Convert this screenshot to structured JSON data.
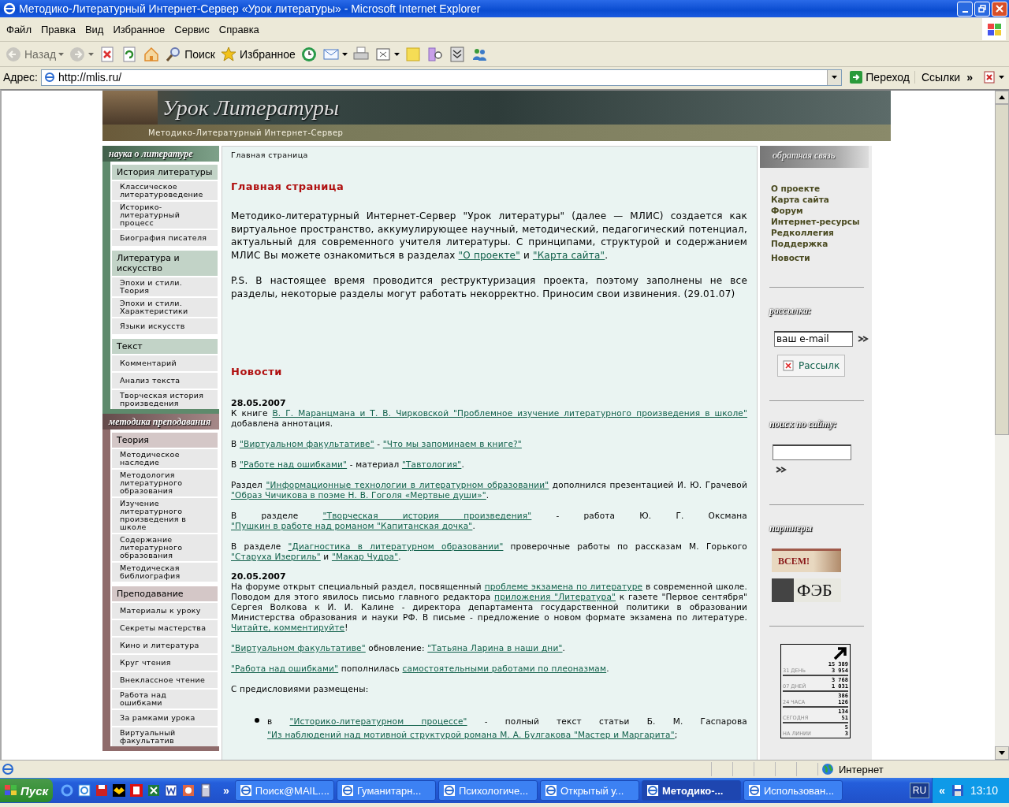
{
  "window": {
    "title": "Методико-Литературный Интернет-Сервер «Урок литературы» - Microsoft Internet Explorer"
  },
  "menu": [
    "Файл",
    "Правка",
    "Вид",
    "Избранное",
    "Сервис",
    "Справка"
  ],
  "toolbar": [
    {
      "kind": "back",
      "label": "Назад",
      "disabled": true,
      "dropdown": true
    },
    {
      "kind": "forward",
      "disabled": true,
      "dropdown": true
    },
    {
      "kind": "stop",
      "disabled": false,
      "dropdown": false
    },
    {
      "kind": "refresh",
      "disabled": false,
      "dropdown": false
    },
    {
      "kind": "home",
      "disabled": false,
      "dropdown": false
    },
    {
      "kind": "search",
      "label": "Поиск",
      "disabled": false,
      "dropdown": false
    },
    {
      "kind": "favorites",
      "label": "Избранное",
      "disabled": false,
      "dropdown": false
    },
    {
      "kind": "history",
      "disabled": false,
      "dropdown": false
    },
    {
      "kind": "mail",
      "disabled": false,
      "dropdown": true
    },
    {
      "kind": "print",
      "disabled": false,
      "dropdown": false
    },
    {
      "kind": "edit",
      "disabled": false,
      "dropdown": true
    },
    {
      "kind": "note",
      "disabled": false,
      "dropdown": false
    },
    {
      "kind": "research",
      "disabled": false,
      "dropdown": false
    },
    {
      "kind": "archive",
      "disabled": false,
      "dropdown": false
    },
    {
      "kind": "people",
      "disabled": false,
      "dropdown": false
    }
  ],
  "address": {
    "label": "Адрес:",
    "value": "http://mlis.ru/",
    "go": "Переход",
    "links": "Ссылки",
    "chevron": "»"
  },
  "site": {
    "title": "Урок Литературы",
    "subtitle": "Методико-Литературный Интернет-Сервер"
  },
  "left_sections": [
    {
      "heading": "наука о литературе",
      "color": "#5e8a6c",
      "groups": [
        {
          "title": "История литературы",
          "items": [
            "Классическое литературоведение",
            "Историко-литературный процесс",
            "Биография писателя"
          ]
        },
        {
          "title": "Литература и искусство",
          "items": [
            "Эпохи и стили. Теория",
            "Эпохи и стили. Характеристики",
            "Языки искусств"
          ]
        },
        {
          "title": "Текст",
          "items": [
            "Комментарий",
            "Анализ текста",
            "Творческая история произведения"
          ]
        }
      ]
    },
    {
      "heading": "методика преподавания",
      "color": "#8f6b6b",
      "groups": [
        {
          "title": "Теория",
          "items": [
            "Методическое наследие",
            "Методология литературного образования",
            "Изучение литературного произведения в школе",
            "Содержание литературного образования",
            "Методическая библиография"
          ]
        },
        {
          "title": "Преподавание",
          "items": [
            "Материалы к уроку",
            "Секреты мастерства",
            "Кино и литература",
            "Круг чтения",
            "Внеклассное чтение",
            "Работа над ошибками",
            "За рамками урока",
            "Виртуальный факультатив"
          ]
        }
      ]
    }
  ],
  "main": {
    "breadcrumb": "Главная страница",
    "heading": "Главная страница",
    "intro": [
      [
        {
          "kind": "text",
          "text": "Методико-литературный Интернет-Сервер \"Урок литературы\" (далее — МЛИС) создается как виртуальное пространство, аккумулирующее научный, методический, педагогический потенциал, актуальный для современного учителя литературы. С принципами, структурой и содержанием МЛИС Вы можете ознакомиться в разделах "
        },
        {
          "kind": "link",
          "text": "\"О проекте\""
        },
        {
          "kind": "text",
          "text": " и "
        },
        {
          "kind": "link",
          "text": "\"Карта сайта\""
        },
        {
          "kind": "text",
          "text": "."
        }
      ],
      [
        {
          "kind": "text",
          "text": "P.S. В настоящее время проводится реструктуризация проекта, поэтому заполнены не все разделы, некоторые разделы могут работать некорректно. Приносим свои извинения. (29.01.07)"
        }
      ]
    ],
    "news_heading": "Новости",
    "news": [
      {
        "date": "28.05.2007",
        "paragraphs": [
          [
            {
              "kind": "text",
              "text": "К книге "
            },
            {
              "kind": "link",
              "text": "В. Г. Маранцмана и Т. В. Чирковской \"Проблемное изучение литературного произведения в школе\""
            },
            {
              "kind": "text",
              "text": " добавлена аннотация."
            }
          ],
          [
            {
              "kind": "text",
              "text": "В "
            },
            {
              "kind": "link",
              "text": "\"Виртуальном факультативе\""
            },
            {
              "kind": "text",
              "text": " - "
            },
            {
              "kind": "link",
              "text": "\"Что мы запоминаем в книге?\""
            }
          ],
          [
            {
              "kind": "text",
              "text": "В "
            },
            {
              "kind": "link",
              "text": "\"Работе над ошибками\""
            },
            {
              "kind": "text",
              "text": " - материал "
            },
            {
              "kind": "link",
              "text": "\"Тавтология\""
            },
            {
              "kind": "text",
              "text": "."
            }
          ],
          [
            {
              "kind": "text",
              "text": "Раздел "
            },
            {
              "kind": "link",
              "text": "\"Информационные технологии в литературном образовании\""
            },
            {
              "kind": "text",
              "text": " дополнился презентацией И. Ю. Грачевой "
            },
            {
              "kind": "link",
              "text": "\"Образ Чичикова в поэме Н. В. Гоголя «Мертвые души»\""
            },
            {
              "kind": "text",
              "text": "."
            }
          ],
          [
            {
              "kind": "text",
              "text": "В разделе "
            },
            {
              "kind": "link",
              "text": "\"Творческая история произведения\""
            },
            {
              "kind": "text",
              "text": " - работа Ю. Г. Оксмана "
            },
            {
              "kind": "link",
              "text": "\"Пушкин в работе над романом \"Капитанская дочка\""
            },
            {
              "kind": "text",
              "text": "."
            }
          ],
          [
            {
              "kind": "text",
              "text": "В разделе "
            },
            {
              "kind": "link",
              "text": "\"Диагностика в литературном образовании\""
            },
            {
              "kind": "text",
              "text": " проверочные работы по рассказам М. Горького "
            },
            {
              "kind": "link",
              "text": "\"Старуха Изергиль\""
            },
            {
              "kind": "text",
              "text": " и "
            },
            {
              "kind": "link",
              "text": "\"Макар Чудра\""
            },
            {
              "kind": "text",
              "text": "."
            }
          ]
        ]
      },
      {
        "date": "20.05.2007",
        "paragraphs": [
          [
            {
              "kind": "text",
              "text": "На форуме открыт специальный раздел, посвященный "
            },
            {
              "kind": "link",
              "text": "проблеме экзамена по литературе"
            },
            {
              "kind": "text",
              "text": " в современной школе. Поводом для этого явилось письмо главного редактора "
            },
            {
              "kind": "link",
              "text": "приложения \"Литература\""
            },
            {
              "kind": "text",
              "text": " к газете \"Первое сентября\" Сергея Волкова к И. И. Калине - директора департамента государственной политики в образовании Министерства образования и науки РФ. В письме - предложение о новом формате экзамена по литературе. "
            },
            {
              "kind": "link",
              "text": "Читайте, комментируйте"
            },
            {
              "kind": "text",
              "text": "!"
            }
          ],
          [
            {
              "kind": "link",
              "text": "\"Виртуальном факультативе\""
            },
            {
              "kind": "text",
              "text": " обновление: "
            },
            {
              "kind": "link",
              "text": "\"Татьяна Ларина в наши дни\""
            },
            {
              "kind": "text",
              "text": "."
            }
          ],
          [
            {
              "kind": "link",
              "text": "\"Работа над ошибками\""
            },
            {
              "kind": "text",
              "text": " пополнилась "
            },
            {
              "kind": "link",
              "text": "самостоятельными работами по плеоназмам"
            },
            {
              "kind": "text",
              "text": "."
            }
          ],
          [
            {
              "kind": "text",
              "text": "С предисловиями размещены:"
            }
          ]
        ],
        "bullets": [
          [
            {
              "kind": "text",
              "text": "в "
            },
            {
              "kind": "link",
              "text": "\"Историко-литературном процессе\""
            },
            {
              "kind": "text",
              "text": " - полный текст статьи Б. М. Гаспарова "
            },
            {
              "kind": "link",
              "text": "\"Из наблюдений над мотивной структурой романа М. А. Булгакова \"Мастер и Маргарита\""
            },
            {
              "kind": "text",
              "text": ";"
            }
          ]
        ]
      }
    ]
  },
  "right": {
    "heading": "обратная связь",
    "links": [
      "О проекте",
      "Карта сайта",
      "Форум",
      "Интернет-ресурсы",
      "Редколлегия",
      "Поддержка",
      "Новости"
    ],
    "mailing": {
      "heading": "рассылка:",
      "value": "ваш e-mail",
      "button": "Рассылк"
    },
    "search": {
      "heading": "поиск по сайту:"
    },
    "partners": {
      "heading": "партнеры",
      "banners": [
        "ВСЕМ!",
        "ФЭБ"
      ]
    },
    "counter": [
      {
        "label": "31 ДЕНЬ",
        "values": [
          "15 389",
          "3 954"
        ]
      },
      {
        "label": "07 ДНЕЙ",
        "values": [
          "3 768",
          "1 031"
        ]
      },
      {
        "label": "24 ЧАСА",
        "values": [
          "386",
          "126"
        ]
      },
      {
        "label": "СЕГОДНЯ",
        "values": [
          "134",
          "51"
        ]
      },
      {
        "label": "НА ЛИНИИ",
        "values": [
          "5",
          "3"
        ]
      }
    ]
  },
  "status_bar": {
    "zone": "Интернет"
  },
  "taskbar": {
    "start": "Пуск",
    "more": "»",
    "tasks": [
      {
        "label": "Поиск@MAIL....",
        "selected": false
      },
      {
        "label": "Гуманитарн...",
        "selected": false
      },
      {
        "label": "Психологиче...",
        "selected": false
      },
      {
        "label": "Открытый у...",
        "selected": false
      },
      {
        "label": "Методико-...",
        "selected": true
      },
      {
        "label": "Использован...",
        "selected": false
      }
    ],
    "language": "RU",
    "tray_toggle": "«",
    "time": "13:10"
  }
}
